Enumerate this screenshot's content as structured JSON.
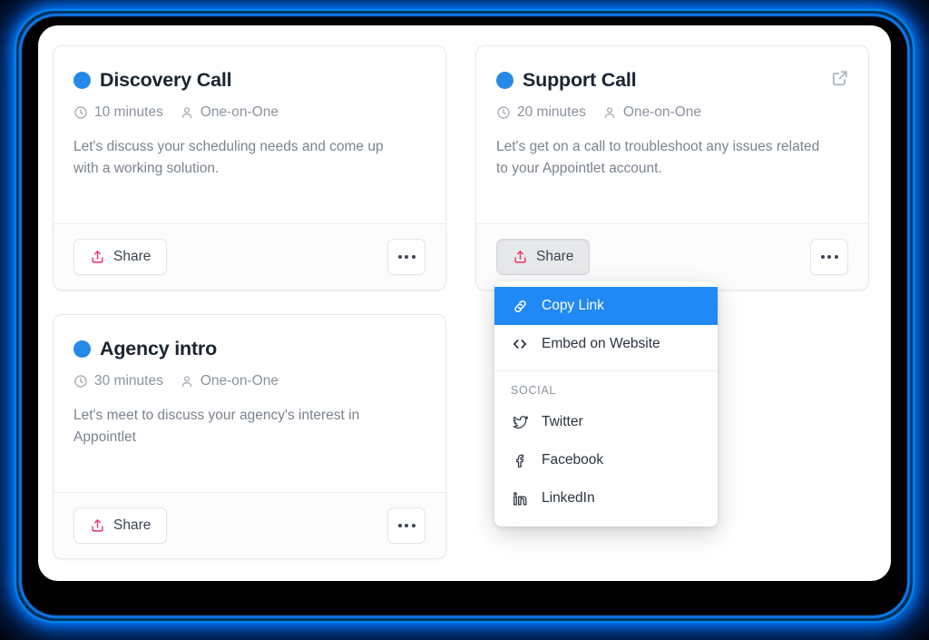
{
  "window": {
    "accent_blue": "#2089f5",
    "dot_blue": "#2589e8",
    "share_pink": "#e8336d",
    "panel_background": "#ffffff",
    "glow_color": "#0a6eff"
  },
  "cards": [
    {
      "id": "discovery-call",
      "dot_color": "#2589e8",
      "title": "Discovery Call",
      "duration": "10 minutes",
      "meeting_type": "One-on-One",
      "description": "Let's discuss your scheduling needs and come up with a working solution.",
      "share_label": "Share",
      "share_active": false,
      "has_external_link": false,
      "clock_icon": "clock-icon",
      "person_icon": "person-icon",
      "share_icon": "share-upload-icon",
      "more_icon": "ellipsis-icon"
    },
    {
      "id": "support-call",
      "dot_color": "#2589e8",
      "title": "Support Call",
      "duration": "20 minutes",
      "meeting_type": "One-on-One",
      "description": "Let's get on a call to troubleshoot any issues related to your Appointlet account.",
      "share_label": "Share",
      "share_active": true,
      "has_external_link": true,
      "external_link_icon": "external-link-icon",
      "clock_icon": "clock-icon",
      "person_icon": "person-icon",
      "share_icon": "share-upload-icon",
      "more_icon": "ellipsis-icon"
    },
    {
      "id": "agency-intro",
      "dot_color": "#2589e8",
      "title": "Agency intro",
      "duration": "30 minutes",
      "meeting_type": "One-on-One",
      "description": "Let's meet to discuss your agency's interest in Appointlet",
      "share_label": "Share",
      "share_active": false,
      "has_external_link": false,
      "clock_icon": "clock-icon",
      "person_icon": "person-icon",
      "share_icon": "share-upload-icon",
      "more_icon": "ellipsis-icon"
    }
  ],
  "share_menu": {
    "open_for": "support-call",
    "items": [
      {
        "label": "Copy Link",
        "icon": "link-chain-icon",
        "highlighted": true
      },
      {
        "label": "Embed on Website",
        "icon": "code-brackets-icon",
        "highlighted": false
      }
    ],
    "section_label": "SOCIAL",
    "social_items": [
      {
        "label": "Twitter",
        "icon": "twitter-icon"
      },
      {
        "label": "Facebook",
        "icon": "facebook-icon"
      },
      {
        "label": "LinkedIn",
        "icon": "linkedin-icon"
      }
    ]
  }
}
